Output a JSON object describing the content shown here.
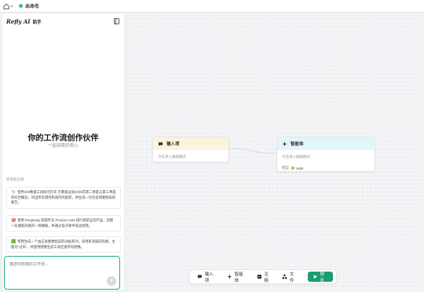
{
  "topbar": {
    "home_icon": "home-icon",
    "title": "未命名",
    "status_color": "#35c18a"
  },
  "sidebar": {
    "brand_logo": "Refly AI",
    "brand_sub": "助手",
    "hero_title": "你的工作流创作伙伴",
    "hero_subtitle": "一起探索好奇心",
    "suggest_label": "获取新灵感",
    "suggestions": [
      {
        "emoji": "🐚",
        "text": "使用100数据工具研究历年 巴黎奥运会2025年第二季度与第三季度的综合概览，列出所有增持和减持的股票，并生成一份包含简要图表的报告。"
      },
      {
        "emoji": "🎯",
        "text": "使用 Perplexity 获取昨天 Product Hunt 排行榜前五的产品，创建一份播客风格的一周播报，并通过电子邮件发送给我。"
      },
      {
        "emoji": "🟩",
        "text": "帮我生成一个由五张图像组成的动画系列，采用新海诚的风格，主题为“过去”，并使用图像生成工具连接所有图像。"
      }
    ],
    "chat_placeholder": "描述你想要的工作流..."
  },
  "canvas": {
    "nodes": {
      "input": {
        "title": "输入项",
        "placeholder": "点击进入编辑模式",
        "header_color": "#fdf3dc"
      },
      "agent": {
        "title": "智能体",
        "placeholder": "点击进入编辑模式",
        "model_label": "模型",
        "model_value": "Auto",
        "header_color": "#e2f6fa"
      }
    }
  },
  "toolbar": {
    "input_label": "输入项",
    "agent_label": "智能体",
    "note_label": "注释",
    "file_label": "文件",
    "run_label": "预览",
    "run_color": "#1a9e6e"
  }
}
